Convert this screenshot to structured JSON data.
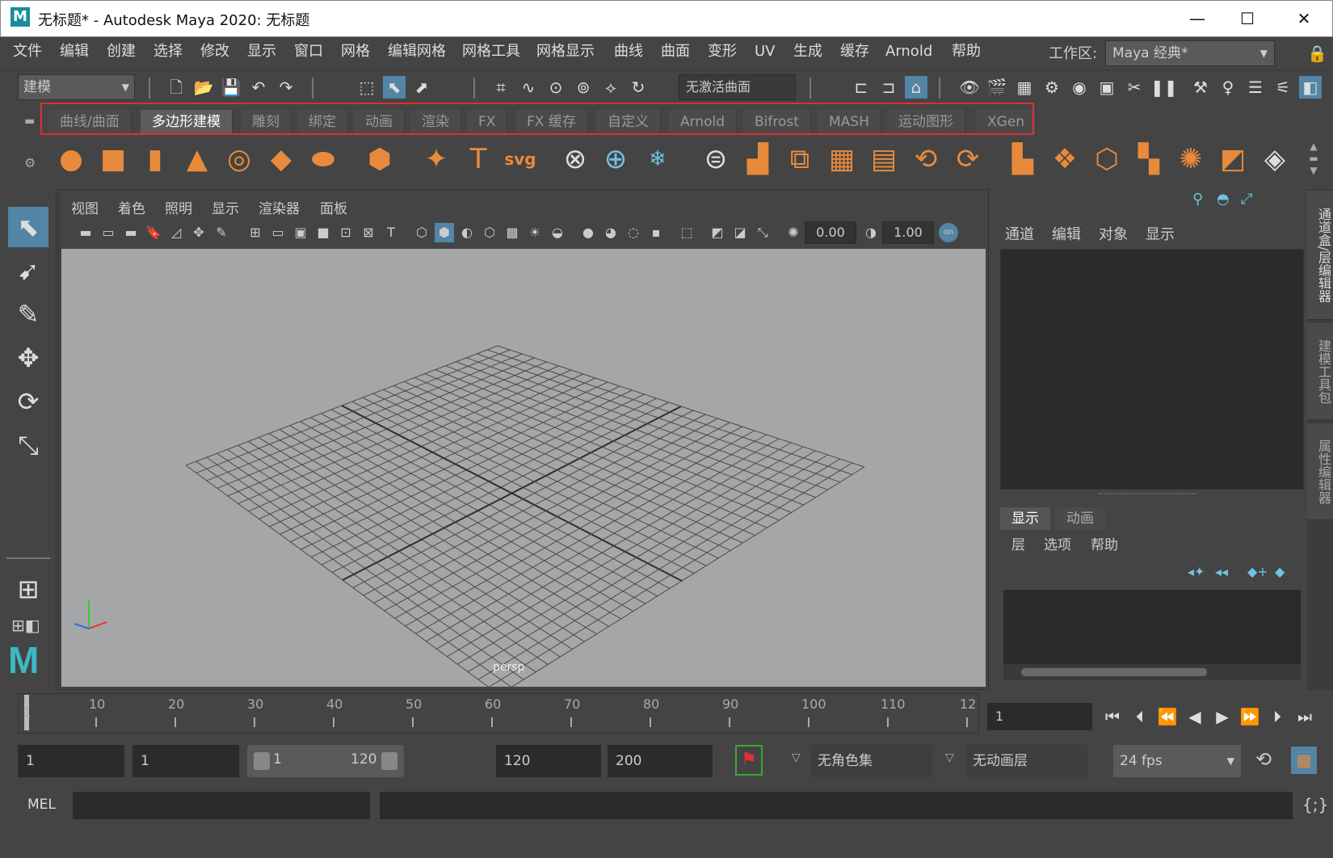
{
  "window": {
    "title": "无标题* - Autodesk Maya 2020: 无标题",
    "logo": "M",
    "minimize": "—",
    "maximize": "☐",
    "close": "✕"
  },
  "menubar": {
    "items": [
      "文件",
      "编辑",
      "创建",
      "选择",
      "修改",
      "显示",
      "窗口",
      "网格",
      "编辑网格",
      "网格工具",
      "网格显示",
      "曲线",
      "曲面",
      "变形",
      "UV",
      "生成",
      "缓存",
      "Arnold",
      "帮助"
    ],
    "workspace_label": "工作区:",
    "workspace_value": "Maya 经典*"
  },
  "toolbar": {
    "mode": "建模",
    "live_surface": "无激活曲面"
  },
  "shelf": {
    "tabs": [
      "曲线/曲面",
      "多边形建模",
      "雕刻",
      "绑定",
      "动画",
      "渲染",
      "FX",
      "FX 缓存",
      "自定义",
      "Arnold",
      "Bifrost",
      "MASH",
      "运动图形",
      "XGen"
    ],
    "active_tab": "多边形建模",
    "highlight_color": "#e03030"
  },
  "viewport": {
    "menu": [
      "视图",
      "着色",
      "照明",
      "显示",
      "渲染器",
      "面板"
    ],
    "value_a": "0.00",
    "value_b": "1.00",
    "camera": "persp",
    "background": "#a5a6a7"
  },
  "channel_box": {
    "menu": [
      "通道",
      "编辑",
      "对象",
      "显示"
    ]
  },
  "side_tabs": [
    "通道盒/层编辑器",
    "建模工具包",
    "属性编辑器"
  ],
  "layer_editor": {
    "tabs": [
      "显示",
      "动画"
    ],
    "active_tab": "显示",
    "menu": [
      "层",
      "选项",
      "帮助"
    ]
  },
  "timeline": {
    "ticks": [
      "10",
      "20",
      "30",
      "40",
      "50",
      "60",
      "70",
      "80",
      "90",
      "100",
      "110",
      "12"
    ],
    "start_label": "1",
    "current_frame": "1"
  },
  "range": {
    "start": "1",
    "playback_start": "1",
    "slider_start": "1",
    "slider_end": "120",
    "playback_end": "120",
    "end": "200",
    "character_set": "无角色集",
    "anim_layer": "无动画层",
    "fps": "24 fps"
  },
  "command": {
    "label": "MEL"
  },
  "colors": {
    "accent": "#5285a6",
    "shelf_icon": "#e88a3c"
  }
}
